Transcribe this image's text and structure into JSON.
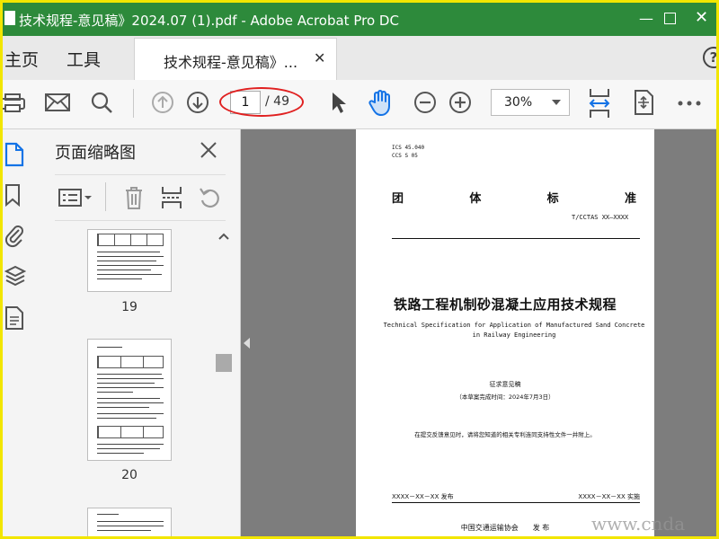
{
  "window": {
    "title": "技术规程-意见稿》2024.07 (1).pdf - Adobe Acrobat Pro DC"
  },
  "tabs": {
    "home": "主页",
    "tools": "工具",
    "document": "技术规程-意见稿》...",
    "help": "?"
  },
  "toolbar": {
    "current_page": "1",
    "total_pages": "/ 49",
    "zoom": "30%"
  },
  "panel": {
    "title": "页面缩略图",
    "thumbnails": [
      {
        "page": "19"
      },
      {
        "page": "20"
      }
    ]
  },
  "document": {
    "ics": "ICS 45.040",
    "ccs": "CCS S 05",
    "standard_chars": [
      "团",
      "体",
      "标",
      "准"
    ],
    "code": "T/CCTAS XX—XXXX",
    "title_cn": "铁路工程机制砂混凝土应用技术规程",
    "title_en": "Technical Specification for Application of Manufactured Sand Concrete in Railway Engineering",
    "draft": "征求意见稿",
    "draft_date": "（本草案完成时间：2024年7月3日）",
    "note": "在提交反馈意见时，请将您知道的相关专利连同支持性文件一并附上。",
    "issue_date": "XXXX－XX－XX 发布",
    "impl_date": "XXXX－XX－XX 实施",
    "publisher": "中国交通运输协会　　发 布"
  },
  "watermark": "www.cnda",
  "colors": {
    "titlebar": "#2d8a3b",
    "accent": "#1473e6",
    "highlight": "#e02020",
    "frame": "#f2e600"
  }
}
